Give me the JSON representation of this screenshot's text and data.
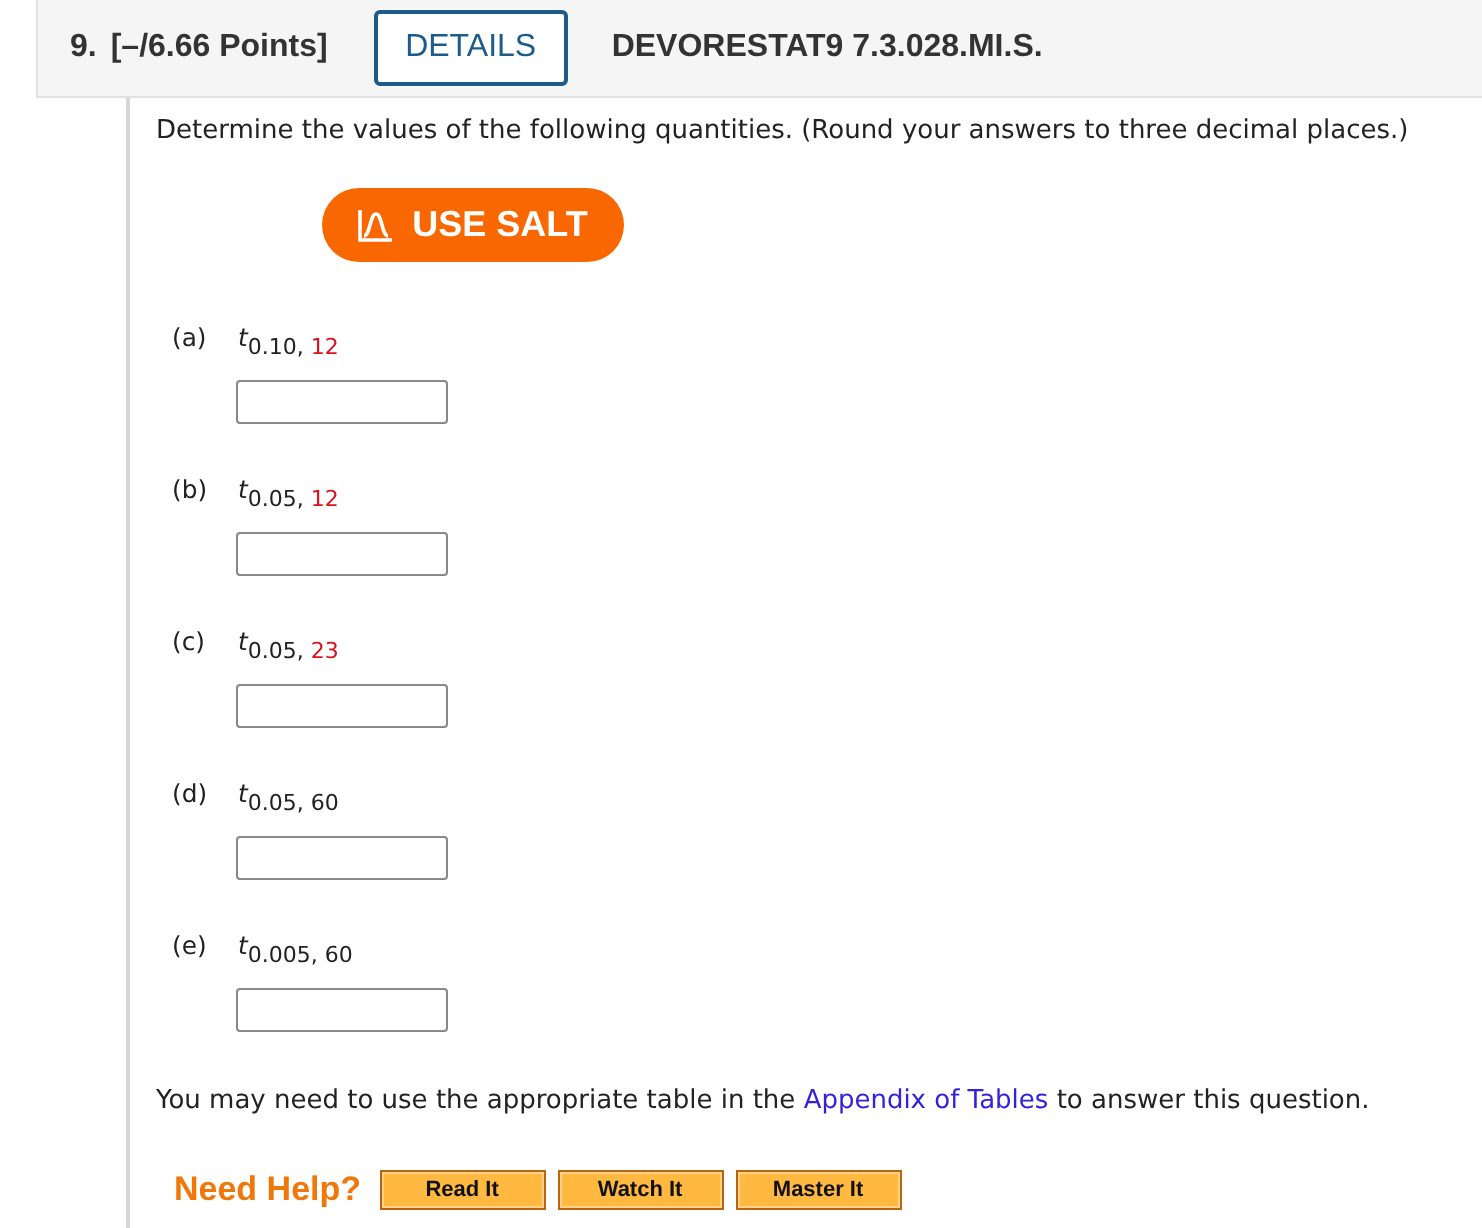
{
  "question": {
    "number": "9.",
    "points": "[–/6.66 Points]",
    "details_button": "DETAILS",
    "code": "DEVORESTAT9 7.3.028.MI.S."
  },
  "instructions": "Determine the values of the following quantities. (Round your answers to three decimal places.)",
  "salt_button": "USE SALT",
  "parts": [
    {
      "label": "(a)",
      "symbol": "t",
      "subscript": "0.10,",
      "df": "12",
      "df_highlighted": true
    },
    {
      "label": "(b)",
      "symbol": "t",
      "subscript": "0.05,",
      "df": "12",
      "df_highlighted": true
    },
    {
      "label": "(c)",
      "symbol": "t",
      "subscript": "0.05,",
      "df": "23",
      "df_highlighted": true
    },
    {
      "label": "(d)",
      "symbol": "t",
      "subscript": "0.05,",
      "df": "60",
      "df_highlighted": false
    },
    {
      "label": "(e)",
      "symbol": "t",
      "subscript": "0.005,",
      "df": "60",
      "df_highlighted": false
    }
  ],
  "note": {
    "before": "You may need to use the appropriate table in the",
    "link": "Appendix of Tables",
    "after": "to answer this question."
  },
  "help": {
    "label": "Need Help?",
    "buttons": [
      "Read It",
      "Watch It",
      "Master It"
    ]
  }
}
